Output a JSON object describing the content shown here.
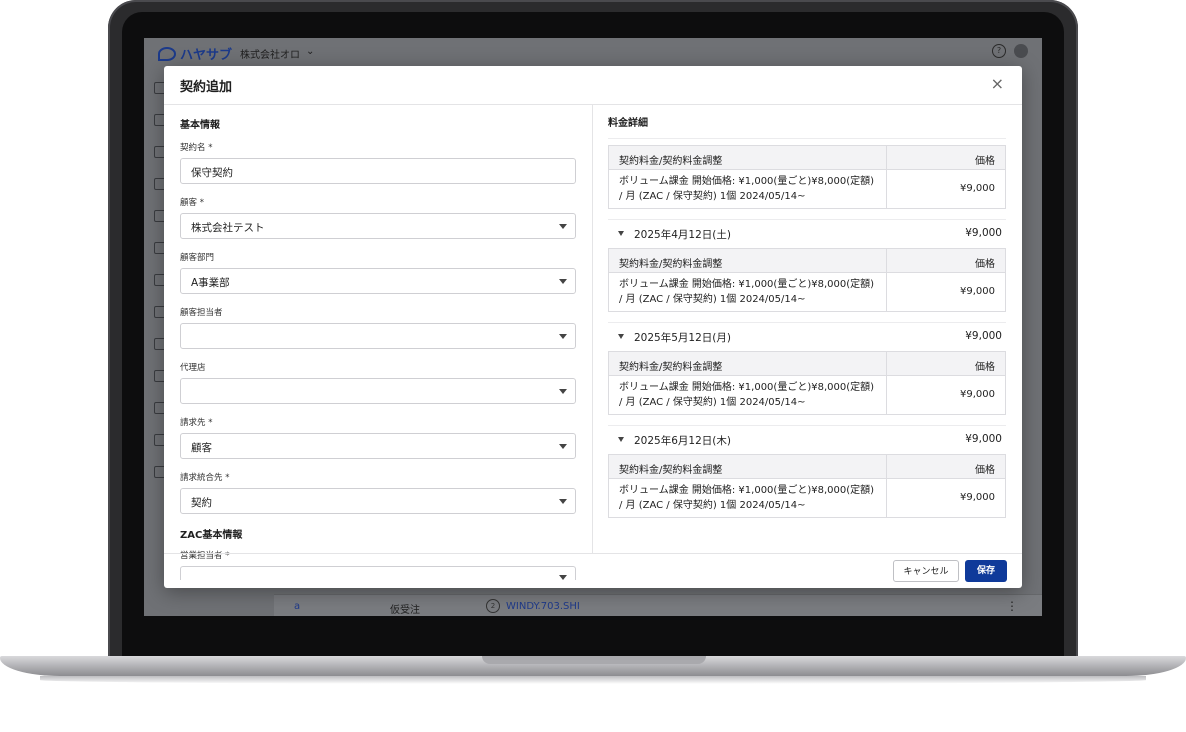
{
  "app": {
    "logo_text": "ハヤサブ",
    "company": "株式会社オロ",
    "company_caret": "⌄",
    "help_icon": "?"
  },
  "modal": {
    "title": "契約追加",
    "close": "×",
    "basic_section": "基本情報",
    "fields": [
      {
        "label": "契約名 *",
        "value": "保守契約",
        "dropdown": false
      },
      {
        "label": "顧客 *",
        "value": "株式会社テスト",
        "dropdown": true
      },
      {
        "label": "顧客部門",
        "value": "A事業部",
        "dropdown": true
      },
      {
        "label": "顧客担当者",
        "value": "",
        "dropdown": true
      },
      {
        "label": "代理店",
        "value": "",
        "dropdown": true
      },
      {
        "label": "請求先 *",
        "value": "顧客",
        "dropdown": true
      },
      {
        "label": "請求統合先 *",
        "value": "契約",
        "dropdown": true
      }
    ],
    "zac_section": "ZAC基本情報",
    "zac_field_label": "営業担当者 *",
    "pricing_title": "料金詳細",
    "table_header": {
      "item": "契約料金/契約料金調整",
      "price": "価格"
    },
    "row_desc_line1": "ボリューム課金 開始価格: ¥1,000(量ごと)¥8,000(定額)",
    "row_desc_line2": "/ 月 (ZAC / 保守契約) 1個 2024/05/14~",
    "first_block_price": "¥9,000",
    "months": [
      {
        "date": "2025年4月12日(土)",
        "amount": "¥9,000",
        "price": "¥9,000"
      },
      {
        "date": "2025年5月12日(月)",
        "amount": "¥9,000",
        "price": "¥9,000"
      },
      {
        "date": "2025年6月12日(木)",
        "amount": "¥9,000",
        "price": "¥9,000"
      }
    ],
    "cancel_label": "キャンセル",
    "save_label": "保存"
  },
  "background_row": {
    "col1": "a",
    "col2": "仮受注",
    "col3_num": "2",
    "col3_text": "WINDY.703.SHI",
    "kebab": "⋮"
  }
}
